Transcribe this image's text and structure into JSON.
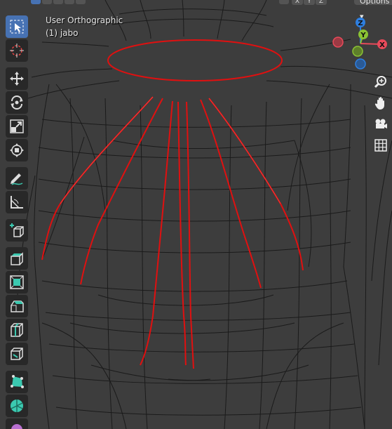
{
  "header": {
    "axis_buttons": [
      "X",
      "Y",
      "Z"
    ],
    "options_label": "Options"
  },
  "viewport": {
    "view_name": "User Orthographic",
    "object_label": "(1) jabo"
  },
  "gizmo": {
    "z_label": "Z",
    "y_label": "Y",
    "x_label": "X",
    "colors": {
      "x": "#e84a5a",
      "y": "#8ac233",
      "z": "#2e7fe0",
      "neg_x": "#9c3a44",
      "neg_y": "#5e7f2a",
      "neg_z": "#2a5a96"
    }
  },
  "toolbar": {
    "tools": [
      "select-box",
      "cursor",
      "move",
      "rotate",
      "scale",
      "transform",
      "annotate",
      "measure",
      "add-cube",
      "extrude-region",
      "inset-faces",
      "bevel",
      "loop-cut",
      "knife",
      "poly-build",
      "spin",
      "smooth"
    ]
  },
  "right_tools": [
    "zoom",
    "pan",
    "camera-view",
    "toggle-orthographic"
  ],
  "colors": {
    "background": "#3d3d3d",
    "wire": "#111111",
    "selected_edge": "#e01010",
    "accent": "#4772b3"
  }
}
